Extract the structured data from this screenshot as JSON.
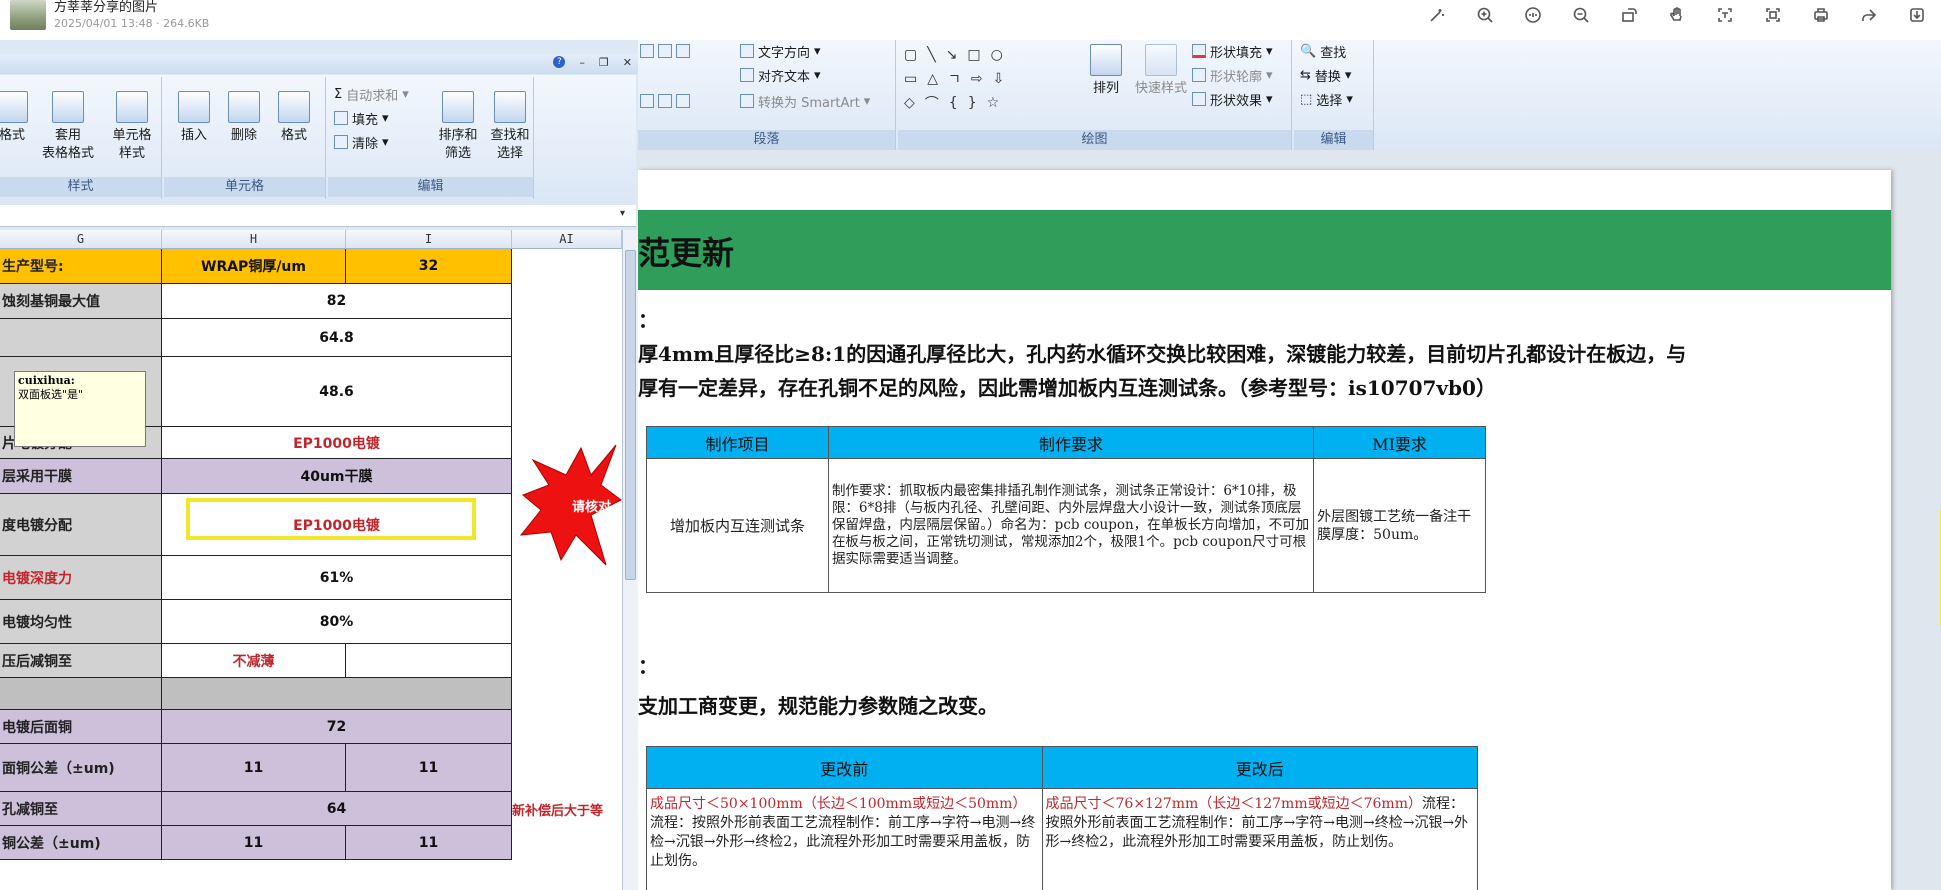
{
  "viewer": {
    "file_name": "方莘莘分享的图片",
    "file_meta": "2025/04/01 13:48 · 264.6KB",
    "tools": [
      "magic-icon",
      "zoom-in-icon",
      "fit-icon",
      "zoom-out-icon",
      "rotate-icon",
      "hand-icon",
      "crop-icon",
      "scan-icon",
      "print-icon",
      "share-icon",
      "download-icon"
    ]
  },
  "excel": {
    "ribbon": {
      "style_group": {
        "name": "样式",
        "format_label": "格式",
        "apply_label": "套用\n表格格式",
        "cell_style_label": "单元格\n样式"
      },
      "cells_group": {
        "name": "单元格",
        "insert": "插入",
        "delete": "删除",
        "format": "格式"
      },
      "edit_group": {
        "name": "编辑",
        "autosum": "自动求和",
        "fill": "填充",
        "clear": "清除",
        "sort": "排序和\n筛选",
        "find": "查找和\n选择"
      }
    },
    "columns": [
      "G",
      "H",
      "I",
      "AI"
    ],
    "rows": [
      {
        "label": "生产型号:",
        "h": "WRAP铜厚/um",
        "i": "32",
        "style": "header"
      },
      {
        "label": "蚀刻基铜最大值",
        "h": "82"
      },
      {
        "label": "",
        "h": "64.8"
      },
      {
        "label": "",
        "h": "48.6"
      },
      {
        "label": "片电镀分配",
        "h": "EP1000电镀",
        "red": true
      },
      {
        "label": "层采用干膜",
        "h": "40um干膜",
        "style": "purple"
      },
      {
        "label": "度电镀分配",
        "h": "EP1000电镀",
        "red": true
      },
      {
        "label": "电镀深度力",
        "h": "61%",
        "redlabel": true
      },
      {
        "label": "电镀均匀性",
        "h": "80%"
      },
      {
        "label": "压后减铜至",
        "h": "不减薄",
        "i": "",
        "split": true,
        "red": true
      },
      {
        "label": "",
        "h": "",
        "style": "gray"
      },
      {
        "label": "电镀后面铜",
        "h": "72",
        "style": "purple"
      },
      {
        "label": "面铜公差（±um)",
        "h": "11",
        "i": "11",
        "split": true,
        "style": "purple"
      },
      {
        "label": "孔减铜至",
        "h": "64",
        "style": "purple"
      },
      {
        "label": "铜公差（±um)",
        "h": "11",
        "i": "11",
        "split": true,
        "style": "purple"
      }
    ],
    "side_note": "新补偿后大于等",
    "comment": {
      "author": "cuixihua:",
      "text": "双面板选\"是\""
    },
    "star_text": "请核对"
  },
  "word": {
    "ribbon": {
      "para": {
        "name": "段落",
        "text_dir": "文字方向",
        "align_text": "对齐文本",
        "smartart": "转换为 SmartArt"
      },
      "draw": {
        "name": "绘图",
        "arrange": "排列",
        "quick_style": "快速样式",
        "shape_fill": "形状填充",
        "shape_outline": "形状轮廓",
        "shape_effect": "形状效果"
      },
      "edit": {
        "name": "编辑",
        "find": "查找",
        "replace": "替换",
        "select": "选择"
      }
    },
    "title": "范更新",
    "h1": "：",
    "p1": "厚4mm且厚径比≥8:1的因通孔厚径比大，孔内药水循环交换比较困难，深镀能力较差，目前切片孔都设计在板边，与",
    "p2": "厚有一定差异，存在孔铜不足的风险，因此需增加板内互连测试条。（参考型号：is10707vb0）",
    "table1": {
      "headers": [
        "制作项目",
        "制作要求",
        "MI要求"
      ],
      "item": "增加板内互连测试条",
      "req": "制作要求：抓取板内最密集排插孔制作测试条，测试条正常设计：6*10排，极限：6*8排（与板内孔径、孔壁间距、内外层焊盘大小设计一致，测试条顶底层保留焊盘，内层隔层保留。）命名为：pcb coupon，在单板长方向增加，不可加在板与板之间，正常铣切测试，常规添加2个，极限1个。pcb coupon尺寸可根据实际需要适当调整。",
      "mi": "外层图镀工艺统一备注干膜厚度：50um。"
    },
    "h2": "：",
    "p3": "支加工商变更，规范能力参数随之改变。",
    "table2": {
      "headers": [
        "更改前",
        "更改后"
      ],
      "before_red": "成品尺寸＜50×100mm（长边＜100mm或短边＜50mm）",
      "before": "流程：按照外形前表面工艺流程制作：前工序→字符→电测→终检→沉银→外形→终检2，此流程外形加工时需要采用盖板，防止划伤。",
      "after_red": "成品尺寸＜76×127mm（长边＜127mm或短边＜76mm）",
      "after": "流程：按照外形前表面工艺流程制作：前工序→字符→电测→终检→沉银→外形→终检2，此流程外形加工时需要采用盖板，防止划伤。"
    }
  }
}
